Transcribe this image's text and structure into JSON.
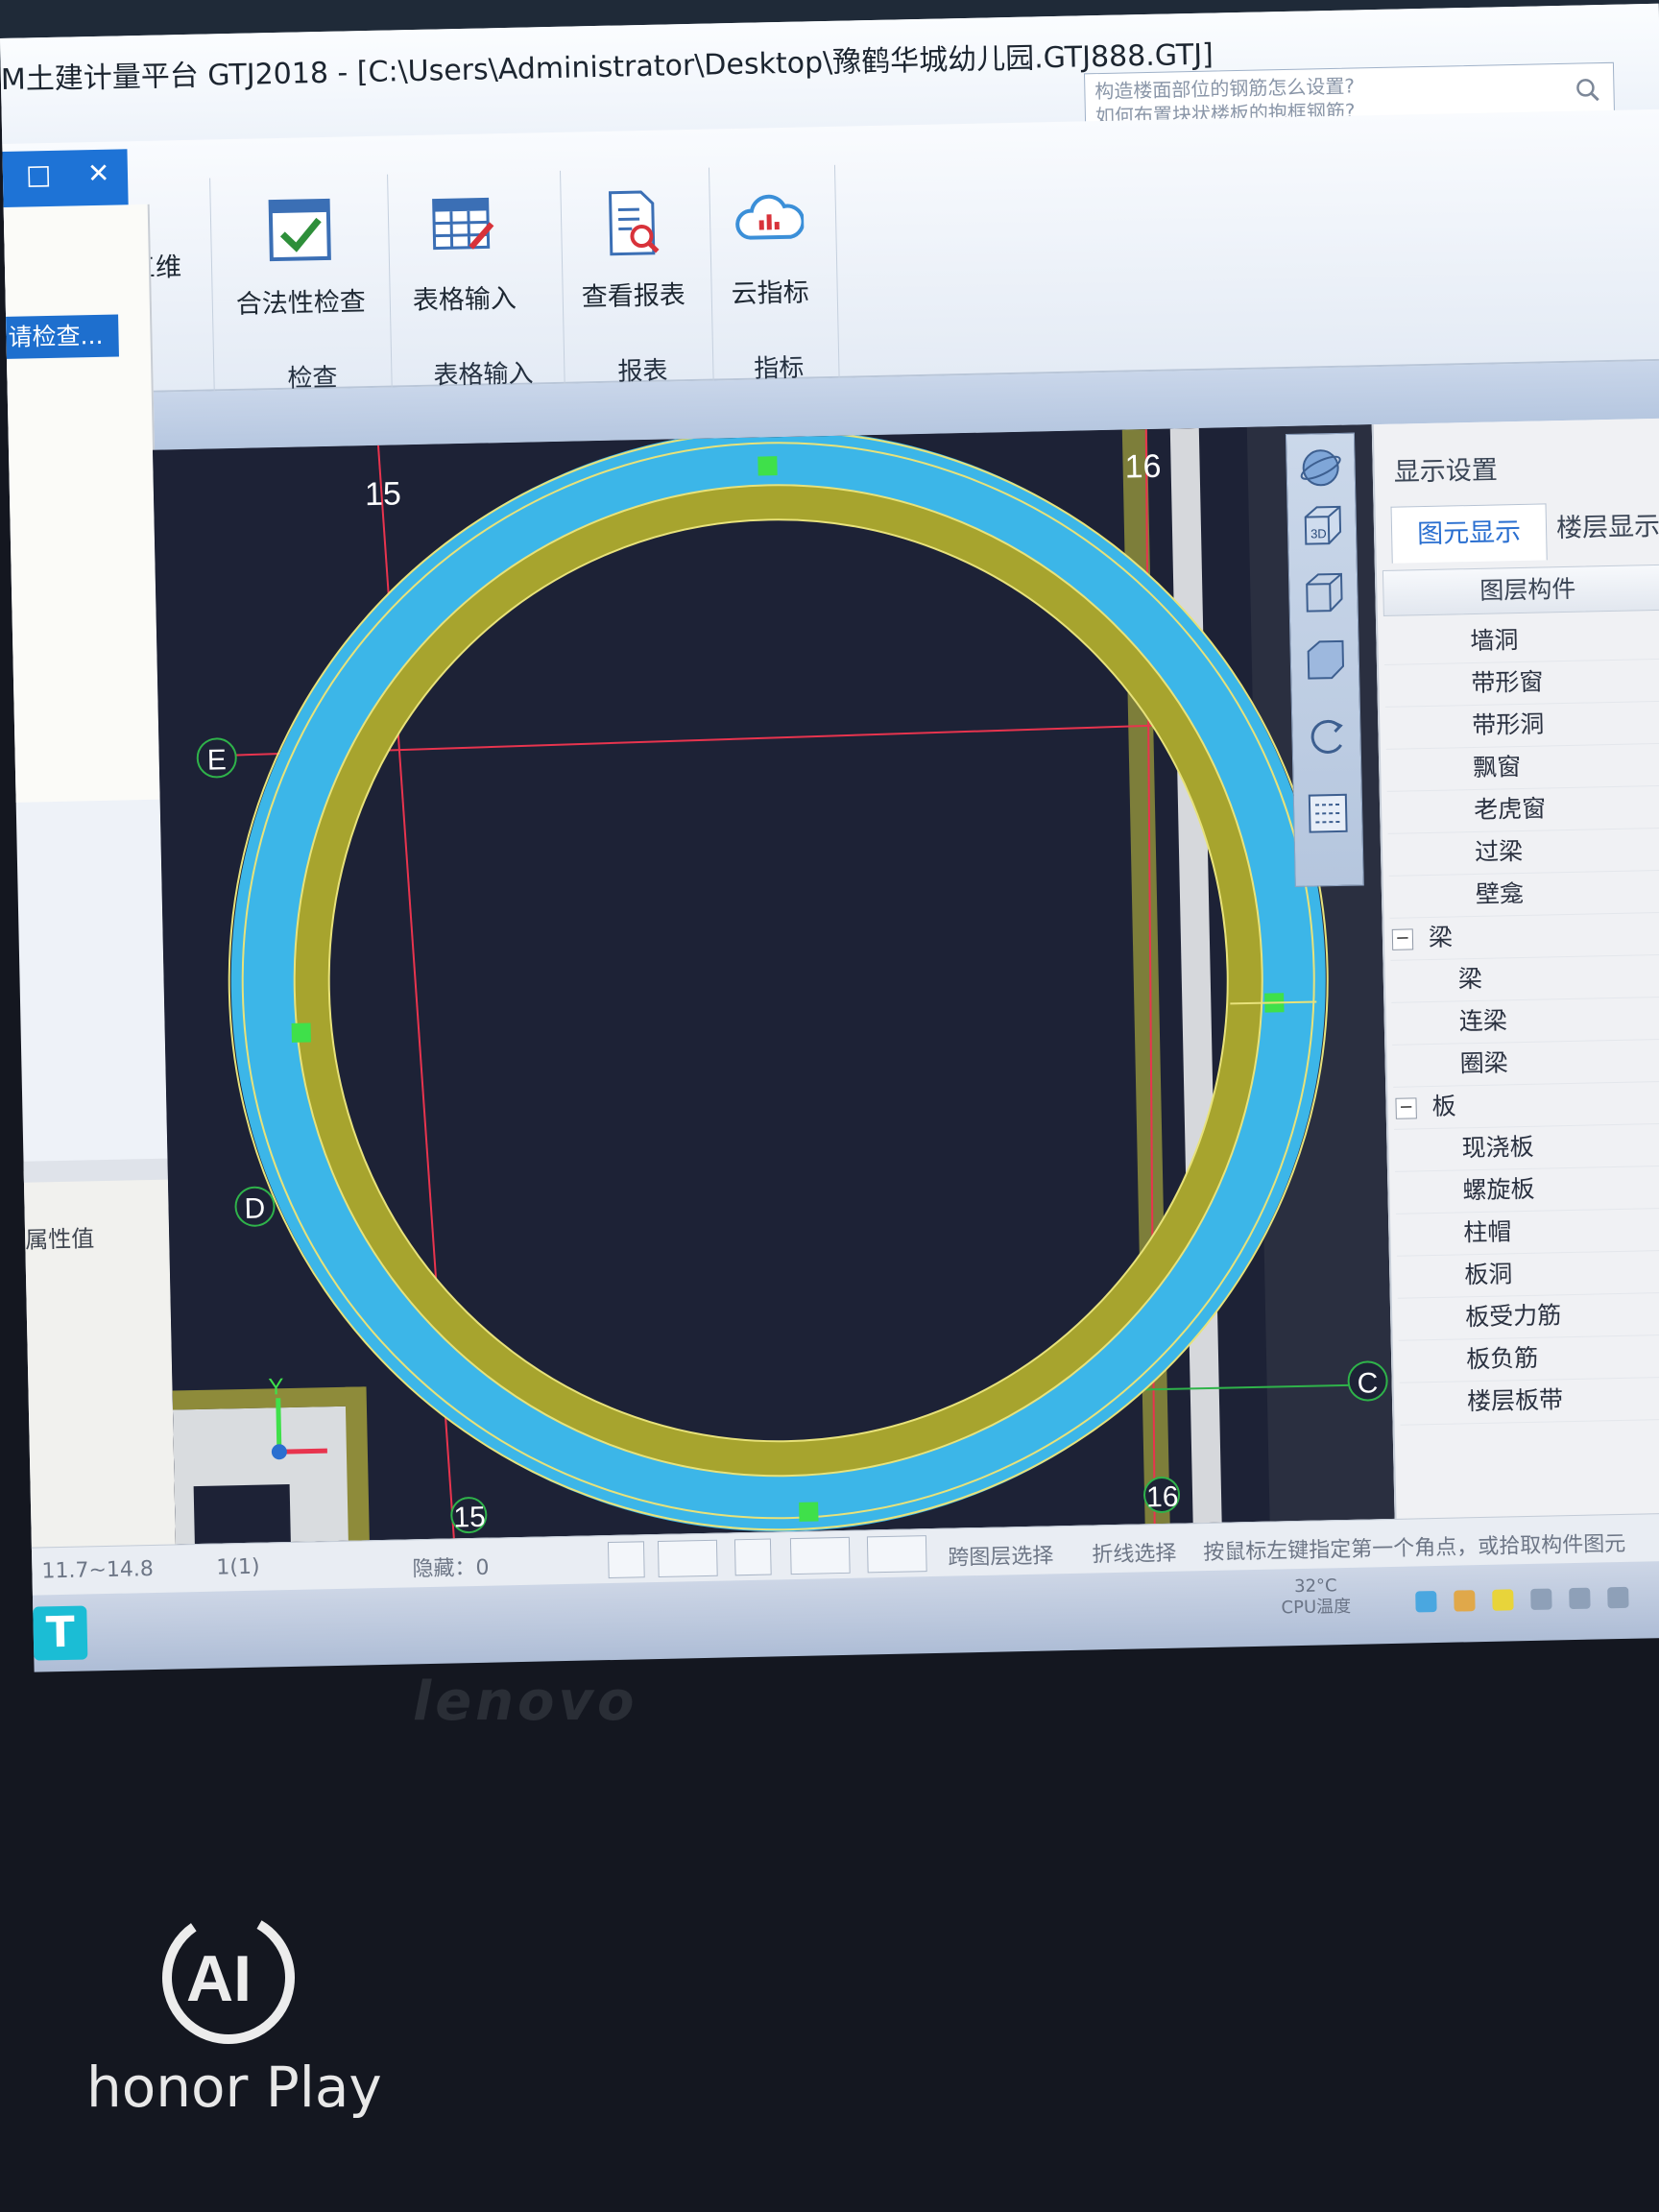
{
  "window": {
    "title": "M土建计量平台 GTJ2018 - [C:\\Users\\Administrator\\Desktop\\豫鹤华城幼儿园.GTJ888.GTJ]",
    "search": {
      "line1": "构造楼面部位的钢筋怎么设置?",
      "line2": "如何布置块状楼板的抱框钢筋?"
    }
  },
  "left_panel": {
    "restore_label": "□",
    "close_label": "✕",
    "selected_item": "请检查...",
    "prop_close": "✕",
    "prop_label": "属性值"
  },
  "ribbon": {
    "buttons": {
      "three_d": "三维",
      "legality_check": "合法性检查",
      "table_input": "表格输入",
      "view_report": "查看报表",
      "cloud_index": "云指标"
    },
    "groups": {
      "check": "检查",
      "table_input": "表格输入",
      "report": "报表",
      "index": "指标"
    }
  },
  "canvas": {
    "axis_labels": {
      "top_15": "15",
      "top_16": "16",
      "bottom_15": "15",
      "bottom_16": "16",
      "E": "E",
      "D": "D",
      "C": "C"
    },
    "ucs": {
      "y_label": "Y"
    }
  },
  "view_toolbar": {
    "three_d_badge": "3D"
  },
  "display_settings": {
    "title": "显示设置",
    "tabs": [
      "图元显示",
      "楼层显示"
    ],
    "column_header": "图层构件",
    "rows": [
      {
        "label": "墙洞",
        "level": 2,
        "expander": ""
      },
      {
        "label": "带形窗",
        "level": 2,
        "expander": ""
      },
      {
        "label": "带形洞",
        "level": 2,
        "expander": ""
      },
      {
        "label": "飘窗",
        "level": 2,
        "expander": ""
      },
      {
        "label": "老虎窗",
        "level": 2,
        "expander": ""
      },
      {
        "label": "过梁",
        "level": 2,
        "expander": ""
      },
      {
        "label": "壁龛",
        "level": 2,
        "expander": ""
      },
      {
        "label": "梁",
        "level": 1,
        "expander": "−"
      },
      {
        "label": "梁",
        "level": 2,
        "expander": ""
      },
      {
        "label": "连梁",
        "level": 2,
        "expander": ""
      },
      {
        "label": "圈梁",
        "level": 2,
        "expander": ""
      },
      {
        "label": "板",
        "level": 1,
        "expander": "−"
      },
      {
        "label": "现浇板",
        "level": 2,
        "expander": ""
      },
      {
        "label": "螺旋板",
        "level": 2,
        "expander": ""
      },
      {
        "label": "柱帽",
        "level": 2,
        "expander": ""
      },
      {
        "label": "板洞",
        "level": 2,
        "expander": ""
      },
      {
        "label": "板受力筋",
        "level": 2,
        "expander": ""
      },
      {
        "label": "板负筋",
        "level": 2,
        "expander": ""
      },
      {
        "label": "楼层板带",
        "level": 2,
        "expander": ""
      }
    ]
  },
  "status_bar": {
    "elevation": "11.7~14.8",
    "floor": "1(1)",
    "hidden": "隐藏：0",
    "cross_layer": "跨图层选择",
    "polyline": "折线选择",
    "hint": "按鼠标左键指定第一个角点，或拾取构件图元"
  },
  "taskbar": {
    "start_label": "T",
    "temperature": "32°C",
    "cpu_label": "CPU温度"
  },
  "device": {
    "brand": "lenovo",
    "watermark": "honor Play",
    "watermark_logo_text": "AI"
  },
  "colors": {
    "canvas_bg": "#1d2236",
    "ring_blue": "#3cb6e8",
    "ring_olive": "#a7a42e",
    "axis_red": "#e8344e",
    "grip_green": "#3fe04a",
    "accent_blue": "#1e6fce"
  }
}
